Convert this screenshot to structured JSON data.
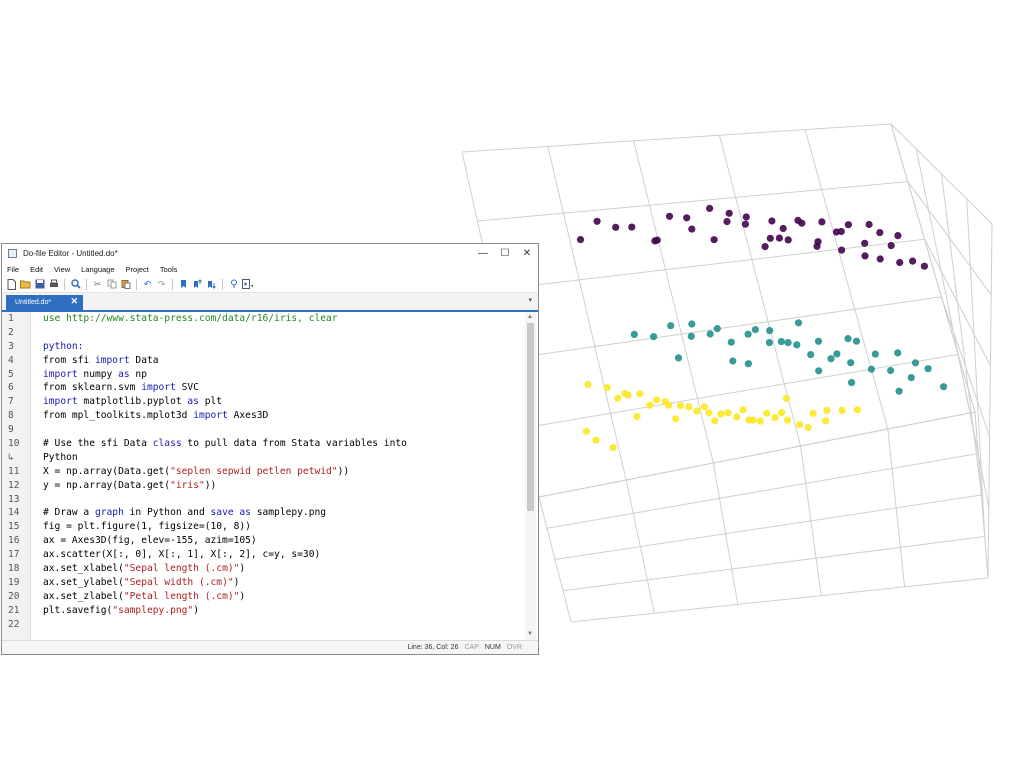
{
  "window": {
    "title": "Do-file Editor - Untitled.do*",
    "controls": {
      "minimize": "—",
      "maximize": "☐",
      "close": "✕"
    }
  },
  "menu": [
    "File",
    "Edit",
    "View",
    "Language",
    "Project",
    "Tools"
  ],
  "toolbar_icons": [
    "new-icon",
    "open-icon",
    "save-icon",
    "print-icon",
    "find-icon",
    "cut-icon",
    "copy-icon",
    "paste-icon",
    "undo-icon",
    "redo-icon",
    "bookmark-toggle-icon",
    "bookmark-prev-icon",
    "bookmark-next-icon",
    "preview-icon",
    "run-icon"
  ],
  "tab": {
    "label": "Untitled.do*",
    "close": "✕"
  },
  "line_numbers": [
    "1",
    "2",
    "3",
    "4",
    "5",
    "6",
    "7",
    "8",
    "9",
    "10",
    "↳",
    "11",
    "12",
    "13",
    "14",
    "15",
    "16",
    "17",
    "18",
    "19",
    "20",
    "21",
    "22"
  ],
  "code_lines": [
    [
      {
        "t": "use http://www.stata-press.com/data/r16/iris, clear",
        "c": "c"
      }
    ],
    [],
    [
      {
        "t": "python:",
        "c": "k"
      }
    ],
    [
      {
        "t": "from sfi ",
        "c": ""
      },
      {
        "t": "import",
        "c": "k"
      },
      {
        "t": " Data",
        "c": ""
      }
    ],
    [
      {
        "t": "import",
        "c": "k"
      },
      {
        "t": " numpy ",
        "c": ""
      },
      {
        "t": "as",
        "c": "k"
      },
      {
        "t": " np",
        "c": ""
      }
    ],
    [
      {
        "t": "from sklearn.svm ",
        "c": ""
      },
      {
        "t": "import",
        "c": "k"
      },
      {
        "t": " SVC",
        "c": ""
      }
    ],
    [
      {
        "t": "import",
        "c": "k"
      },
      {
        "t": " matplotlib.pyplot ",
        "c": ""
      },
      {
        "t": "as",
        "c": "k"
      },
      {
        "t": " plt",
        "c": ""
      }
    ],
    [
      {
        "t": "from mpl_toolkits.mplot3d ",
        "c": ""
      },
      {
        "t": "import",
        "c": "k"
      },
      {
        "t": " Axes3D",
        "c": ""
      }
    ],
    [],
    [
      {
        "t": "# Use the sfi Data ",
        "c": ""
      },
      {
        "t": "class",
        "c": "k"
      },
      {
        "t": " to pull data from Stata variables into",
        "c": ""
      }
    ],
    [
      {
        "t": "Python",
        "c": ""
      }
    ],
    [
      {
        "t": "X = np.array(Data.get(",
        "c": ""
      },
      {
        "t": "\"seplen sepwid petlen petwid\"",
        "c": "s"
      },
      {
        "t": "))",
        "c": ""
      }
    ],
    [
      {
        "t": "y = np.array(Data.get(",
        "c": ""
      },
      {
        "t": "\"iris\"",
        "c": "s"
      },
      {
        "t": "))",
        "c": ""
      }
    ],
    [],
    [
      {
        "t": "# Draw a ",
        "c": ""
      },
      {
        "t": "graph",
        "c": "k"
      },
      {
        "t": " in Python and ",
        "c": ""
      },
      {
        "t": "save as",
        "c": "k"
      },
      {
        "t": " samplepy.png",
        "c": ""
      }
    ],
    [
      {
        "t": "fig = plt.figure(1, figsize=(10, 8))",
        "c": ""
      }
    ],
    [
      {
        "t": "ax = Axes3D(fig, elev=-155, azim=105)",
        "c": ""
      }
    ],
    [
      {
        "t": "ax.scatter(X[:, 0], X[:, 1], X[:, 2], c=y, s=30)",
        "c": ""
      }
    ],
    [
      {
        "t": "ax.set_xlabel(",
        "c": ""
      },
      {
        "t": "\"Sepal length (.cm)\"",
        "c": "s"
      },
      {
        "t": ")",
        "c": ""
      }
    ],
    [
      {
        "t": "ax.set_ylabel(",
        "c": ""
      },
      {
        "t": "\"Sepal width (.cm)\"",
        "c": "s"
      },
      {
        "t": ")",
        "c": ""
      }
    ],
    [
      {
        "t": "ax.set_zlabel(",
        "c": ""
      },
      {
        "t": "\"Petal length (.cm)\"",
        "c": "s"
      },
      {
        "t": ")",
        "c": ""
      }
    ],
    [
      {
        "t": "plt.savefig(",
        "c": ""
      },
      {
        "t": "\"samplepy.png\"",
        "c": "s"
      },
      {
        "t": ")",
        "c": ""
      }
    ],
    []
  ],
  "status": {
    "position": "Line: 36, Col: 26",
    "cap": "CAP",
    "num": "NUM",
    "ovr": "OVR"
  },
  "colors": {
    "accent": "#2f6fc2",
    "keyword": "#1818b8",
    "string": "#b02020",
    "comment": "#1f8a1f"
  },
  "chart_data": {
    "type": "scatter",
    "title": "",
    "series": [
      {
        "color": "#44034f",
        "points": [
          [
            0.1,
            0.9,
            0.25
          ],
          [
            0.2,
            0.85,
            0.22
          ],
          [
            0.3,
            0.92,
            0.26
          ],
          [
            0.35,
            0.75,
            0.2
          ],
          [
            0.4,
            0.8,
            0.24
          ],
          [
            0.45,
            0.88,
            0.27
          ],
          [
            0.5,
            0.7,
            0.23
          ],
          [
            0.55,
            0.78,
            0.21
          ],
          [
            0.6,
            0.82,
            0.28
          ],
          [
            0.62,
            0.66,
            0.24
          ],
          [
            0.65,
            0.72,
            0.3
          ],
          [
            0.68,
            0.86,
            0.22
          ],
          [
            0.7,
            0.6,
            0.26
          ],
          [
            0.72,
            0.78,
            0.32
          ],
          [
            0.75,
            0.68,
            0.25
          ],
          [
            0.78,
            0.74,
            0.28
          ],
          [
            0.8,
            0.58,
            0.3
          ],
          [
            0.82,
            0.64,
            0.27
          ],
          [
            0.85,
            0.7,
            0.33
          ],
          [
            0.88,
            0.52,
            0.29
          ],
          [
            0.9,
            0.6,
            0.31
          ],
          [
            0.92,
            0.66,
            0.35
          ],
          [
            0.95,
            0.5,
            0.34
          ],
          [
            0.5,
            0.95,
            0.18
          ],
          [
            0.45,
            0.98,
            0.16
          ],
          [
            0.15,
            1.0,
            0.19
          ],
          [
            0.25,
            0.6,
            0.24
          ],
          [
            0.3,
            0.7,
            0.28
          ],
          [
            0.58,
            0.88,
            0.3
          ],
          [
            0.62,
            0.92,
            0.27
          ],
          [
            0.72,
            0.9,
            0.29
          ],
          [
            0.78,
            0.84,
            0.33
          ],
          [
            0.84,
            0.8,
            0.36
          ],
          [
            0.88,
            0.76,
            0.38
          ],
          [
            0.93,
            0.74,
            0.4
          ],
          [
            0.97,
            0.6,
            0.42
          ],
          [
            1.0,
            0.55,
            0.45
          ],
          [
            0.4,
            0.6,
            0.22
          ],
          [
            0.55,
            0.62,
            0.25
          ],
          [
            0.65,
            0.55,
            0.28
          ]
        ]
      },
      {
        "color": "#21908d",
        "points": [
          [
            0.2,
            0.4,
            0.6
          ],
          [
            0.25,
            0.35,
            0.62
          ],
          [
            0.3,
            0.45,
            0.58
          ],
          [
            0.35,
            0.3,
            0.64
          ],
          [
            0.4,
            0.38,
            0.63
          ],
          [
            0.42,
            0.5,
            0.6
          ],
          [
            0.45,
            0.42,
            0.66
          ],
          [
            0.5,
            0.35,
            0.65
          ],
          [
            0.52,
            0.48,
            0.62
          ],
          [
            0.55,
            0.4,
            0.68
          ],
          [
            0.58,
            0.55,
            0.66
          ],
          [
            0.6,
            0.32,
            0.7
          ],
          [
            0.62,
            0.46,
            0.69
          ],
          [
            0.65,
            0.52,
            0.72
          ],
          [
            0.68,
            0.38,
            0.7
          ],
          [
            0.7,
            0.6,
            0.73
          ],
          [
            0.72,
            0.45,
            0.74
          ],
          [
            0.75,
            0.55,
            0.76
          ],
          [
            0.78,
            0.36,
            0.72
          ],
          [
            0.8,
            0.62,
            0.78
          ],
          [
            0.82,
            0.5,
            0.75
          ],
          [
            0.85,
            0.58,
            0.8
          ],
          [
            0.88,
            0.42,
            0.77
          ],
          [
            0.9,
            0.66,
            0.82
          ],
          [
            0.92,
            0.55,
            0.79
          ],
          [
            0.95,
            0.48,
            0.83
          ],
          [
            0.98,
            0.7,
            0.86
          ],
          [
            0.3,
            0.58,
            0.67
          ],
          [
            0.48,
            0.62,
            0.71
          ],
          [
            0.66,
            0.7,
            0.75
          ],
          [
            0.74,
            0.72,
            0.8
          ],
          [
            0.86,
            0.78,
            0.84
          ],
          [
            0.36,
            0.22,
            0.61
          ],
          [
            0.56,
            0.26,
            0.66
          ],
          [
            0.76,
            0.28,
            0.72
          ],
          [
            0.44,
            0.66,
            0.69
          ],
          [
            0.64,
            0.3,
            0.64
          ]
        ]
      },
      {
        "color": "#fde725",
        "points": [
          [
            0.05,
            0.3,
            0.75
          ],
          [
            0.1,
            0.2,
            0.78
          ],
          [
            0.12,
            0.35,
            0.8
          ],
          [
            0.15,
            0.15,
            0.82
          ],
          [
            0.18,
            0.4,
            0.79
          ],
          [
            0.2,
            0.25,
            0.85
          ],
          [
            0.22,
            0.45,
            0.81
          ],
          [
            0.25,
            0.1,
            0.88
          ],
          [
            0.28,
            0.3,
            0.86
          ],
          [
            0.3,
            0.5,
            0.84
          ],
          [
            0.32,
            0.2,
            0.9
          ],
          [
            0.35,
            0.35,
            0.89
          ],
          [
            0.38,
            0.55,
            0.87
          ],
          [
            0.4,
            0.15,
            0.93
          ],
          [
            0.42,
            0.4,
            0.91
          ],
          [
            0.45,
            0.25,
            0.95
          ],
          [
            0.48,
            0.5,
            0.92
          ],
          [
            0.5,
            0.05,
            0.97
          ],
          [
            0.52,
            0.35,
            0.94
          ],
          [
            0.55,
            0.2,
            0.98
          ],
          [
            0.58,
            0.45,
            0.96
          ],
          [
            0.6,
            0.3,
            1.0
          ],
          [
            0.62,
            0.1,
            0.99
          ],
          [
            0.65,
            0.4,
            0.97
          ],
          [
            0.02,
            0.1,
            0.92
          ],
          [
            0.04,
            0.05,
            0.96
          ],
          [
            0.08,
            0.0,
            1.0
          ],
          [
            0.14,
            0.5,
            0.77
          ],
          [
            0.24,
            0.6,
            0.8
          ],
          [
            0.34,
            0.62,
            0.83
          ],
          [
            0.44,
            0.6,
            0.86
          ],
          [
            0.54,
            0.58,
            0.89
          ],
          [
            0.26,
            0.02,
            0.94
          ],
          [
            0.36,
            0.08,
            0.96
          ],
          [
            0.46,
            0.02,
            0.99
          ],
          [
            0.16,
            0.25,
            0.88
          ],
          [
            0.56,
            0.62,
            0.84
          ],
          [
            0.66,
            0.55,
            0.91
          ],
          [
            0.7,
            0.48,
            0.93
          ],
          [
            0.74,
            0.4,
            0.95
          ]
        ]
      }
    ]
  }
}
